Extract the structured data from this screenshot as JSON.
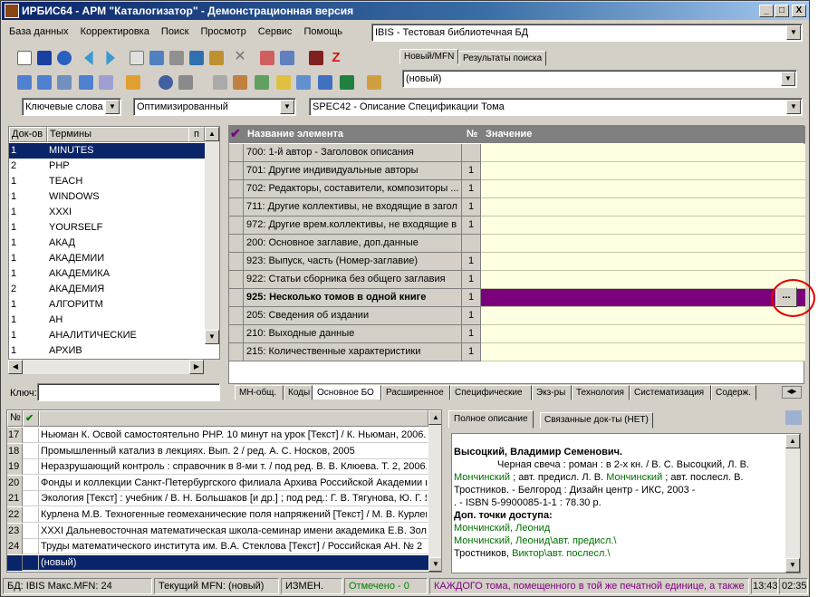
{
  "window": {
    "title": "ИРБИС64 - АРМ \"Каталогизатор\" - Демонстрационная версия",
    "btn_min": "_",
    "btn_max": "□",
    "btn_close": "X"
  },
  "menu": [
    "База данных",
    "Корректировка",
    "Поиск",
    "Просмотр",
    "Сервис",
    "Помощь"
  ],
  "db_combo": {
    "value": "IBIS - Тестовая библиотечная БД"
  },
  "record_tabs": [
    {
      "label": "Новый/MFN"
    },
    {
      "label": "Результаты поиска"
    }
  ],
  "record_combo": {
    "value": "(новый)"
  },
  "search": {
    "mode": "Ключевые слова",
    "method": "Оптимизированный",
    "worksheet": "SPEC42 - Описание Спецификации Тома"
  },
  "terms": {
    "col_count": "Док-ов",
    "col_term": "Термины",
    "col_pin": "п",
    "items": [
      {
        "count": "1",
        "term": "MINUTES"
      },
      {
        "count": "2",
        "term": "PHP"
      },
      {
        "count": "1",
        "term": "TEACH"
      },
      {
        "count": "1",
        "term": "WINDOWS"
      },
      {
        "count": "1",
        "term": "XXXI"
      },
      {
        "count": "1",
        "term": "YOURSELF"
      },
      {
        "count": "1",
        "term": "АКАД"
      },
      {
        "count": "1",
        "term": "АКАДЕМИИ"
      },
      {
        "count": "1",
        "term": "АКАДЕМИКА"
      },
      {
        "count": "2",
        "term": "АКАДЕМИЯ"
      },
      {
        "count": "1",
        "term": "АЛГОРИТМ"
      },
      {
        "count": "1",
        "term": "АН"
      },
      {
        "count": "1",
        "term": "АНАЛИТИЧЕСКИЕ"
      },
      {
        "count": "1",
        "term": "АРХИВ"
      }
    ],
    "key_label": "Ключ:"
  },
  "fields": {
    "col_name": "Название элемента",
    "col_num": "№",
    "col_value": "Значение",
    "check": "✔",
    "rows": [
      {
        "name": "700: 1-й автор - Заголовок описания",
        "num": ""
      },
      {
        "name": "701: Другие индивидуальные авторы",
        "num": "1"
      },
      {
        "name": "702: Редакторы, составители, композиторы ...",
        "num": "1"
      },
      {
        "name": "711: Другие коллективы, не входящие в загол",
        "num": "1"
      },
      {
        "name": "972: Другие врем.коллективы, не входящие в",
        "num": "1"
      },
      {
        "name": "200: Основное заглавие, доп.данные",
        "num": ""
      },
      {
        "name": "923: Выпуск, часть (Номер-заглавие)",
        "num": "1"
      },
      {
        "name": "922: Статьи сборника без общего заглавия",
        "num": "1"
      },
      {
        "name": "925: Несколько томов в одной книге",
        "num": "1"
      },
      {
        "name": "205: Сведения об издании",
        "num": "1"
      },
      {
        "name": "210: Выходные данные",
        "num": "1"
      },
      {
        "name": "215: Количественные характеристики",
        "num": "1"
      }
    ],
    "ellipsis": "...",
    "tabs": [
      "МН-общ.",
      "Коды",
      "Основное БО",
      "Расширенное",
      "Специфические",
      "Экз-ры",
      "Технология",
      "Систематизация",
      "Содерж."
    ]
  },
  "results": {
    "col_num": "№",
    "check": "✔",
    "rows": [
      {
        "n": "17",
        "text": "Ньюман К. Освой самостоятельно PHP. 10 минут на урок [Текст] / К. Ньюман, 2006."
      },
      {
        "n": "18",
        "text": "Промышленный катализ в лекциях. Вып. 2 / ред. А. С. Носков, 2005"
      },
      {
        "n": "19",
        "text": "Неразрушающий контроль : справочник в 8-ми т. / под ред. В. В. Клюева. Т. 2, 2006."
      },
      {
        "n": "20",
        "text": "Фонды и коллекции Санкт-Петербургского филиала Архива Российской Академии н"
      },
      {
        "n": "21",
        "text": "Экология [Текст] : учебник / В. Н. Большаков [и др.] ; под ред.: Г. В. Тягунова, Ю. Г. Я"
      },
      {
        "n": "22",
        "text": "Курлена М.В. Техногенные геомеханические поля напряжений [Текст] / М. В. Курлен"
      },
      {
        "n": "23",
        "text": "XXXI Дальневосточная математическая школа-семинар имени академика Е.В. Зол"
      },
      {
        "n": "24",
        "text": "Труды математического института им. В.А. Стеклова [Текст] / Российская АН. № 2"
      },
      {
        "n": "",
        "text": "(новый)"
      }
    ]
  },
  "description": {
    "tabs": [
      "Полное описание",
      "Связанные док-ты (НЕТ)"
    ],
    "author": "Высоцкий, Владимир Семенович.",
    "line1": "Черная свеча : роман : в 2-х кн. / В. С. Высоцкий, Л. В.",
    "line2a": "Мончинский",
    "line2b": " ; авт. предисл. Л. В. ",
    "line2c": "Мончинский",
    "line2d": " ; авт. послесл. В.",
    "line3": "Тростников. - Белгород : Дизайн центр - ИКС, 2003 -",
    "line4": ". - ISBN 5-9900085-1-1 : 78.30 р.",
    "access_label": "Доп. точки доступа:",
    "acc1": "Мончинский, Леонид",
    "acc2": "Мончинский, Леонид\\авт. предисл.\\",
    "acc3a": "Тростников, ",
    "acc3b": "Виктор\\авт. послесл.\\"
  },
  "statusbar": {
    "db": "БД: IBIS Макс.MFN: 24",
    "current": "Текущий MFN: (новый)",
    "changed": "ИЗМЕН.",
    "marked": "Отмечено - 0",
    "hint": "КАЖДОГО тома, помещенного в той же печатной единице, а также",
    "time1": "13:43",
    "time2": "02:35"
  },
  "colors": {
    "title": "#0a246a",
    "selected_row": "#7b007b",
    "field_bg": "#ffffe1",
    "highlight_ring": "#e00000",
    "marked": "#008000",
    "hint": "#800080"
  }
}
